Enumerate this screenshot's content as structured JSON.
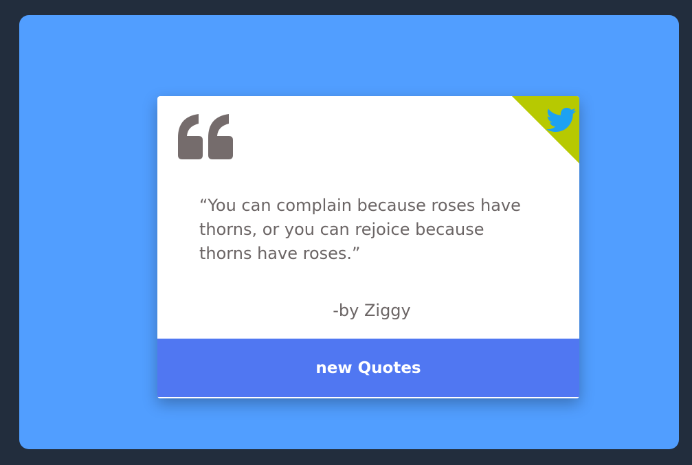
{
  "quote": {
    "text": "“You can complain because roses have thorns, or you can rejoice because thorns have roses.”",
    "author": "-by Ziggy"
  },
  "actions": {
    "new_quote_label": "new Quotes",
    "share_icon": "twitter-icon"
  },
  "colors": {
    "page_background": "#222d3d",
    "frame_background": "#519eff",
    "card_background": "#ffffff",
    "button_background": "#5077f2",
    "corner_ribbon": "#b7c901",
    "twitter_bird": "#1da1f2",
    "quote_text": "#6b6565",
    "quote_mark": "#756c6c"
  }
}
